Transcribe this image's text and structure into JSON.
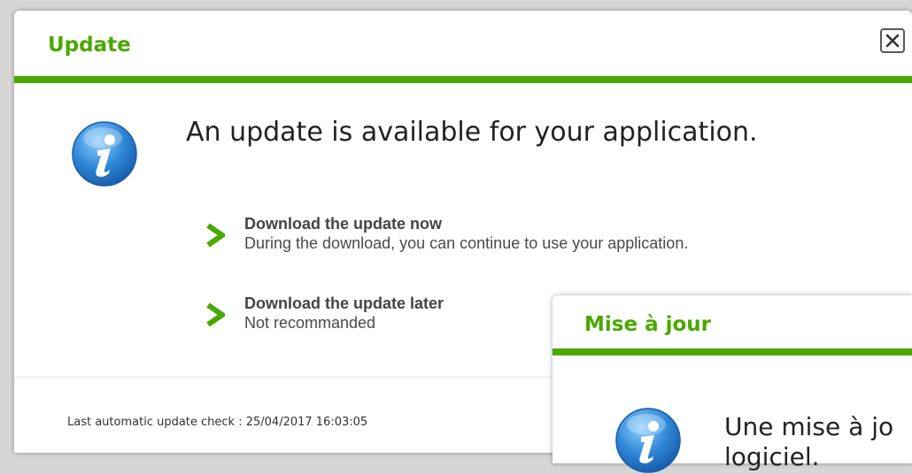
{
  "colors": {
    "accent": "#4aa800",
    "info_blue": "#2e86d6"
  },
  "dialog_en": {
    "title": "Update",
    "close_icon": "close-icon",
    "info_icon": "info-icon",
    "headline": "An update is available for your application.",
    "options": [
      {
        "title": "Download the update now",
        "description": "During the download, you can continue to use your application.",
        "icon": "chevron-right-icon"
      },
      {
        "title": "Download the update later",
        "description": "Not recommanded",
        "icon": "chevron-right-icon"
      }
    ],
    "footer": "Last automatic update check : 25/04/2017 16:03:05"
  },
  "dialog_fr": {
    "title": "Mise à jour",
    "info_icon": "info-icon",
    "headline_line1": "Une mise à jo",
    "headline_line2": "logiciel."
  }
}
